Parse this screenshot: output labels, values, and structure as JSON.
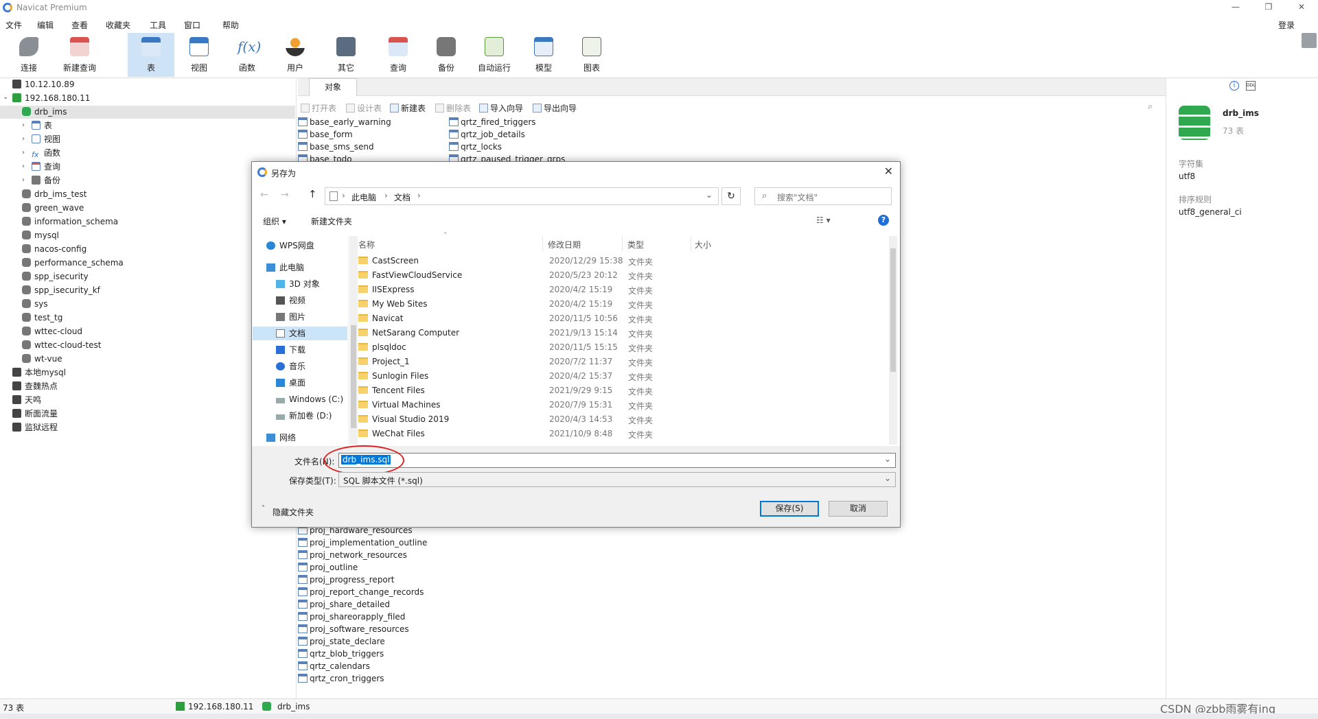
{
  "app": {
    "title": "Navicat Premium",
    "login_label": "登录"
  },
  "menu": [
    "文件",
    "编辑",
    "查看",
    "收藏夹",
    "工具",
    "窗口",
    "帮助"
  ],
  "toolbar": [
    "连接",
    "新建查询",
    "表",
    "视图",
    "函数",
    "用户",
    "其它",
    "查询",
    "备份",
    "自动运行",
    "模型",
    "图表"
  ],
  "sidebar": {
    "connections_top": [
      "10.12.10.89",
      "192.168.180.11"
    ],
    "active_db": "drb_ims",
    "db_children": [
      "表",
      "视图",
      "函数",
      "查询",
      "备份"
    ],
    "databases": [
      "drb_ims_test",
      "green_wave",
      "information_schema",
      "mysql",
      "nacos-config",
      "performance_schema",
      "spp_isecurity",
      "spp_isecurity_kf",
      "sys",
      "test_tg",
      "wttec-cloud",
      "wttec-cloud-test",
      "wt-vue"
    ],
    "connections_bottom": [
      "本地mysql",
      "查魏热点",
      "天鸣",
      "断面流量",
      "监狱远程"
    ]
  },
  "objects": {
    "tab": "对象",
    "tools": [
      "打开表",
      "设计表",
      "新建表",
      "删除表",
      "导入向导",
      "导出向导"
    ],
    "col1_top": [
      "base_early_warning",
      "base_form",
      "base_sms_send",
      "base_todo"
    ],
    "col2_top": [
      "qrtz_fired_triggers",
      "qrtz_job_details",
      "qrtz_locks",
      "qrtz_paused_trigger_grps"
    ],
    "col1_bottom": [
      "proj_hardware_resources",
      "proj_implementation_outline",
      "proj_network_resources",
      "proj_outline",
      "proj_progress_report",
      "proj_report_change_records",
      "proj_share_detailed",
      "proj_shareorapply_filed",
      "proj_software_resources",
      "proj_state_declare",
      "qrtz_blob_triggers",
      "qrtz_calendars",
      "qrtz_cron_triggers"
    ]
  },
  "right_panel": {
    "db_name": "drb_ims",
    "table_count": "73 表",
    "charset_label": "字符集",
    "charset_value": "utf8",
    "collation_label": "排序规则",
    "collation_value": "utf8_general_ci"
  },
  "status": {
    "count": "73 表",
    "connection": "192.168.180.11",
    "database": "drb_ims",
    "watermark": "CSDN @zbb雨雾有ing"
  },
  "dialog": {
    "title": "另存为",
    "breadcrumb": [
      "此电脑",
      "文档"
    ],
    "search_placeholder": "搜索\"文档\"",
    "organize": "组织 ▾",
    "new_folder": "新建文件夹",
    "nav": [
      "WPS网盘",
      "此电脑",
      "3D 对象",
      "视频",
      "图片",
      "文档",
      "下载",
      "音乐",
      "桌面",
      "Windows (C:)",
      "新加卷 (D:)",
      "网络"
    ],
    "columns": [
      "名称",
      "修改日期",
      "类型",
      "大小"
    ],
    "files": [
      {
        "name": "CastScreen",
        "date": "2020/12/29 15:38",
        "type": "文件夹"
      },
      {
        "name": "FastViewCloudService",
        "date": "2020/5/23 20:12",
        "type": "文件夹"
      },
      {
        "name": "IISExpress",
        "date": "2020/4/2 15:19",
        "type": "文件夹"
      },
      {
        "name": "My Web Sites",
        "date": "2020/4/2 15:19",
        "type": "文件夹"
      },
      {
        "name": "Navicat",
        "date": "2020/11/5 10:56",
        "type": "文件夹"
      },
      {
        "name": "NetSarang Computer",
        "date": "2021/9/13 15:14",
        "type": "文件夹"
      },
      {
        "name": "plsqldoc",
        "date": "2020/11/5 15:15",
        "type": "文件夹"
      },
      {
        "name": "Project_1",
        "date": "2020/7/2 11:37",
        "type": "文件夹"
      },
      {
        "name": "Sunlogin Files",
        "date": "2020/4/2 15:37",
        "type": "文件夹"
      },
      {
        "name": "Tencent Files",
        "date": "2021/9/29 9:15",
        "type": "文件夹"
      },
      {
        "name": "Virtual Machines",
        "date": "2020/7/9 15:31",
        "type": "文件夹"
      },
      {
        "name": "Visual Studio 2019",
        "date": "2020/4/3 14:53",
        "type": "文件夹"
      },
      {
        "name": "WeChat Files",
        "date": "2021/10/9 8:48",
        "type": "文件夹"
      }
    ],
    "filename_label": "文件名(N):",
    "filename_value": "drb_ims.sql",
    "filetype_label": "保存类型(T):",
    "filetype_value": "SQL 脚本文件 (*.sql)",
    "hide_folders": "隐藏文件夹",
    "save_button": "保存(S)",
    "cancel_button": "取消"
  }
}
